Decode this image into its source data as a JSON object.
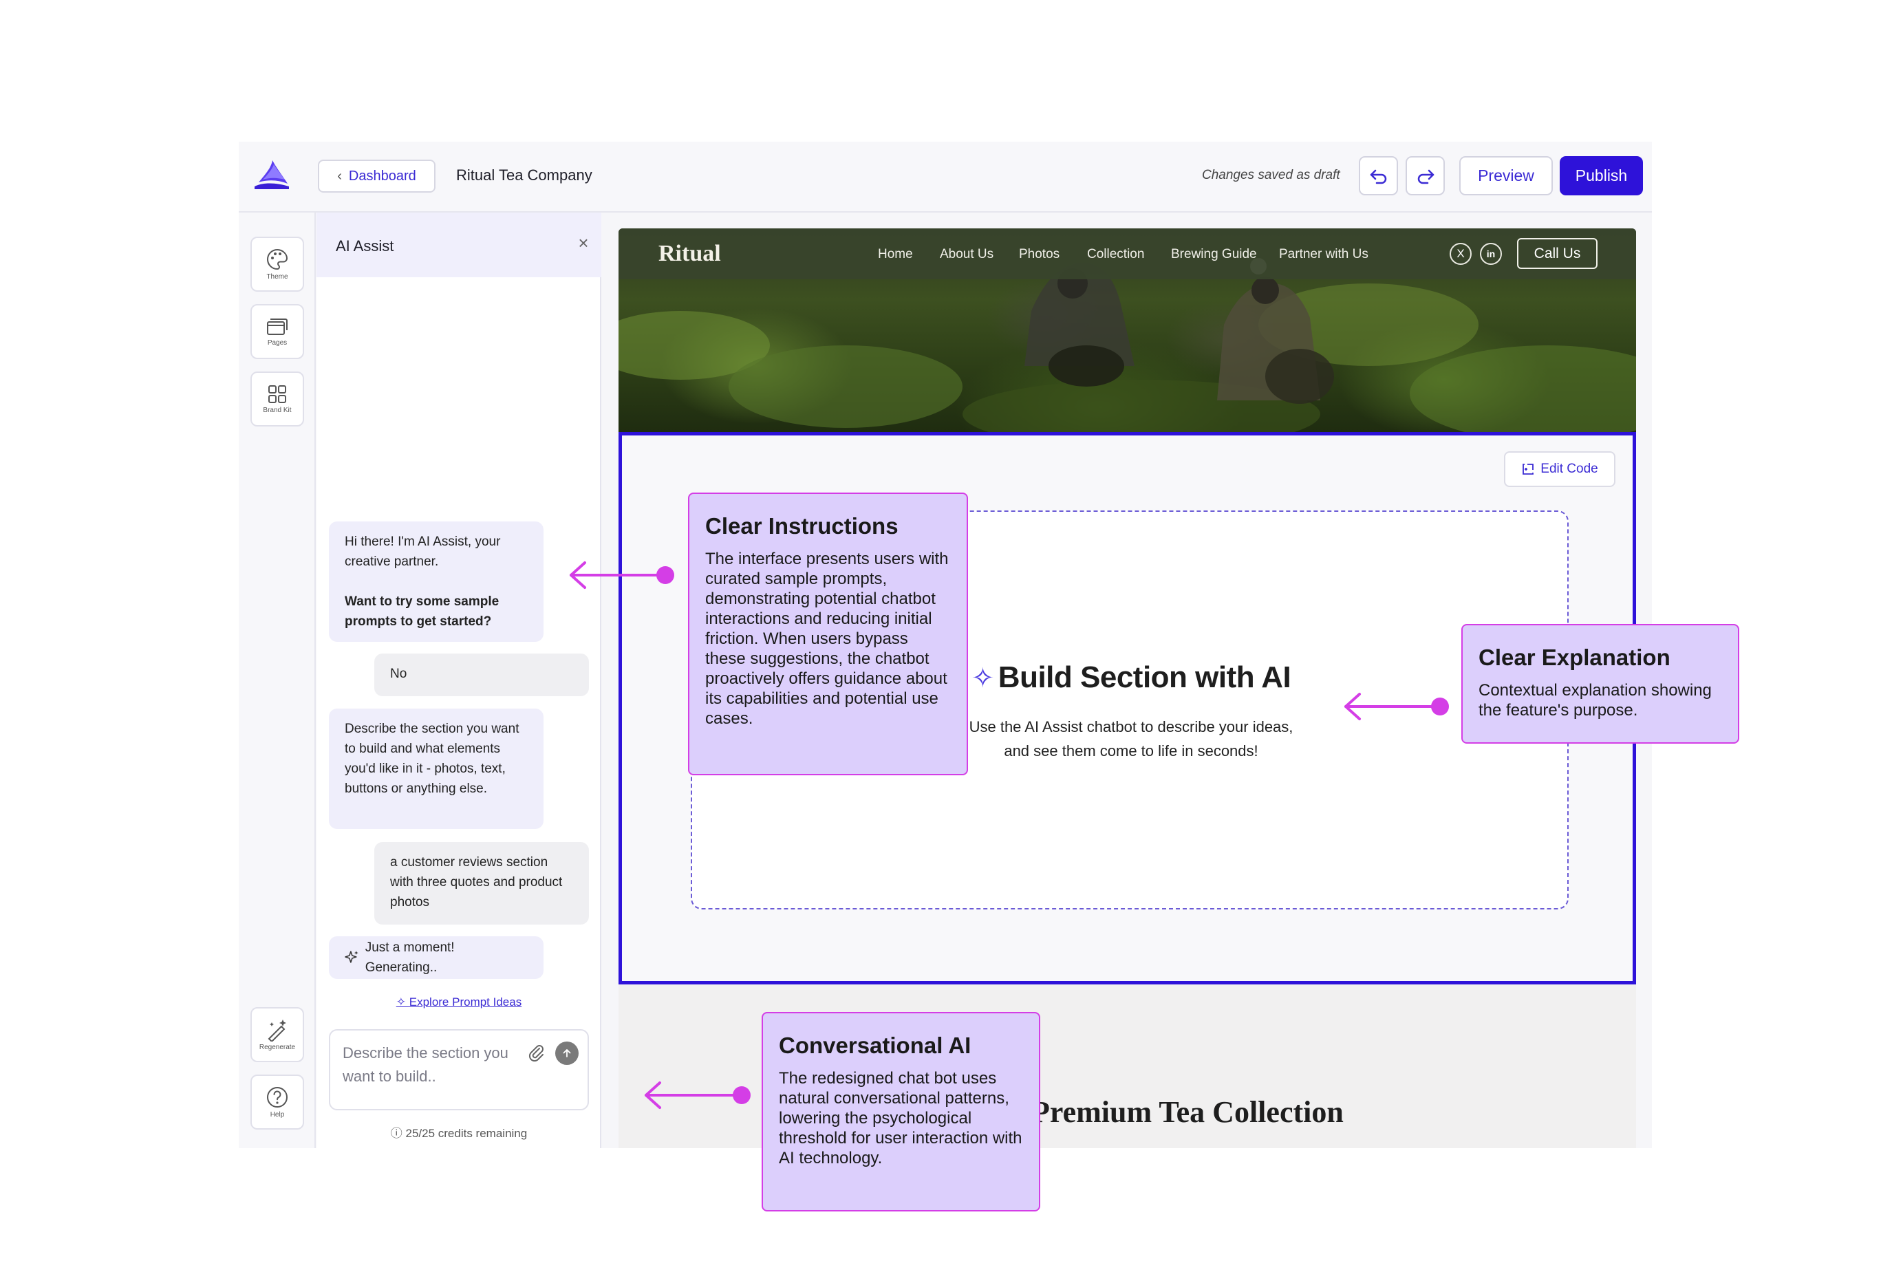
{
  "app": {
    "logo_icon": "brand-wave-logo-icon",
    "dashboard_label": "Dashboard",
    "project_title": "Ritual Tea Company",
    "save_status": "Changes saved as draft",
    "preview_label": "Preview",
    "publish_label": "Publish",
    "accent_color": "#2e12d9"
  },
  "rail": {
    "items": [
      {
        "label": "Theme",
        "icon": "palette-icon"
      },
      {
        "label": "Pages",
        "icon": "pages-icon"
      },
      {
        "label": "Brand Kit",
        "icon": "grid-icon"
      },
      {
        "label": "Regenerate",
        "icon": "magic-wand-icon"
      },
      {
        "label": "Help",
        "icon": "help-icon"
      }
    ]
  },
  "panel": {
    "title": "AI Assist",
    "messages": [
      {
        "role": "ai",
        "text": "Hi there! I'm AI Assist, your creative partner.",
        "strong": "Want to try some sample prompts to get started?"
      },
      {
        "role": "user",
        "text": "No"
      },
      {
        "role": "ai",
        "text": "Describe the section you want to build and what elements you'd like in it - photos, text, buttons or anything else."
      },
      {
        "role": "user",
        "text": "a customer reviews section with three quotes and product photos"
      },
      {
        "role": "ai",
        "text": "Just a moment! Generating.."
      }
    ],
    "explore_label": "Explore Prompt Ideas",
    "input_placeholder": "Describe the section you want to build..",
    "credits": "25/25 credits remaining"
  },
  "site": {
    "logo": "Ritual",
    "nav": [
      "Home",
      "About Us",
      "Photos",
      "Collection",
      "Brewing Guide",
      "Partner with Us"
    ],
    "social": [
      "X",
      "in"
    ],
    "cta_label": "Call Us",
    "edit_code_label": "Edit Code",
    "build_title": "Build Section with AI",
    "build_desc": "Use the AI Assist chatbot to describe your ideas, and see them come to life in seconds!",
    "collection_title": "Premium Tea Collection"
  },
  "callouts": {
    "instructions": {
      "title": "Clear Instructions",
      "text": "The interface presents users with curated sample prompts, demonstrating potential chatbot interactions and reducing initial friction. When users bypass these suggestions, the chatbot proactively offers guidance about its capabilities and potential use cases."
    },
    "explanation": {
      "title": "Clear Explanation",
      "text": "Contextual explanation showing the feature's purpose."
    },
    "conversational": {
      "title": "Conversational AI",
      "text": "The redesigned chat bot uses natural conversational patterns, lowering the psychological threshold for user interaction with AI technology."
    },
    "color": "#d43ee6"
  }
}
